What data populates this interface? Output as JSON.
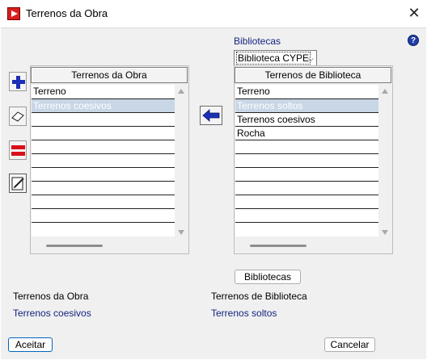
{
  "window": {
    "title": "Terrenos da Obra",
    "close_glyph": "✕",
    "help_glyph": "?"
  },
  "library_selector": {
    "label": "Bibliotecas",
    "selected": "Biblioteca CYPE",
    "chevron": "⌵"
  },
  "left_table": {
    "header": "Terrenos da Obra",
    "column": "Terreno",
    "rows": [
      "Terrenos coesivos",
      "",
      "",
      "",
      "",
      "",
      "",
      "",
      "",
      ""
    ]
  },
  "right_table": {
    "header": "Terrenos de Biblioteca",
    "column": "Terreno",
    "rows": [
      "Terrenos soltos",
      "Terrenos coesivos",
      "Rocha",
      "",
      "",
      "",
      "",
      "",
      "",
      ""
    ]
  },
  "buttons": {
    "bibliotecas": "Bibliotecas",
    "aceitar": "Aceitar",
    "cancelar": "Cancelar"
  },
  "info": {
    "left_label": "Terrenos da Obra",
    "left_value": "Terrenos coesivos",
    "right_label": "Terrenos de Biblioteca",
    "right_value": "Terrenos soltos"
  },
  "colors": {
    "accent_blue": "#1c2fb6",
    "delete_red": "#d8101a",
    "label_blue": "#13237f",
    "selection": "#c8d6e6"
  }
}
